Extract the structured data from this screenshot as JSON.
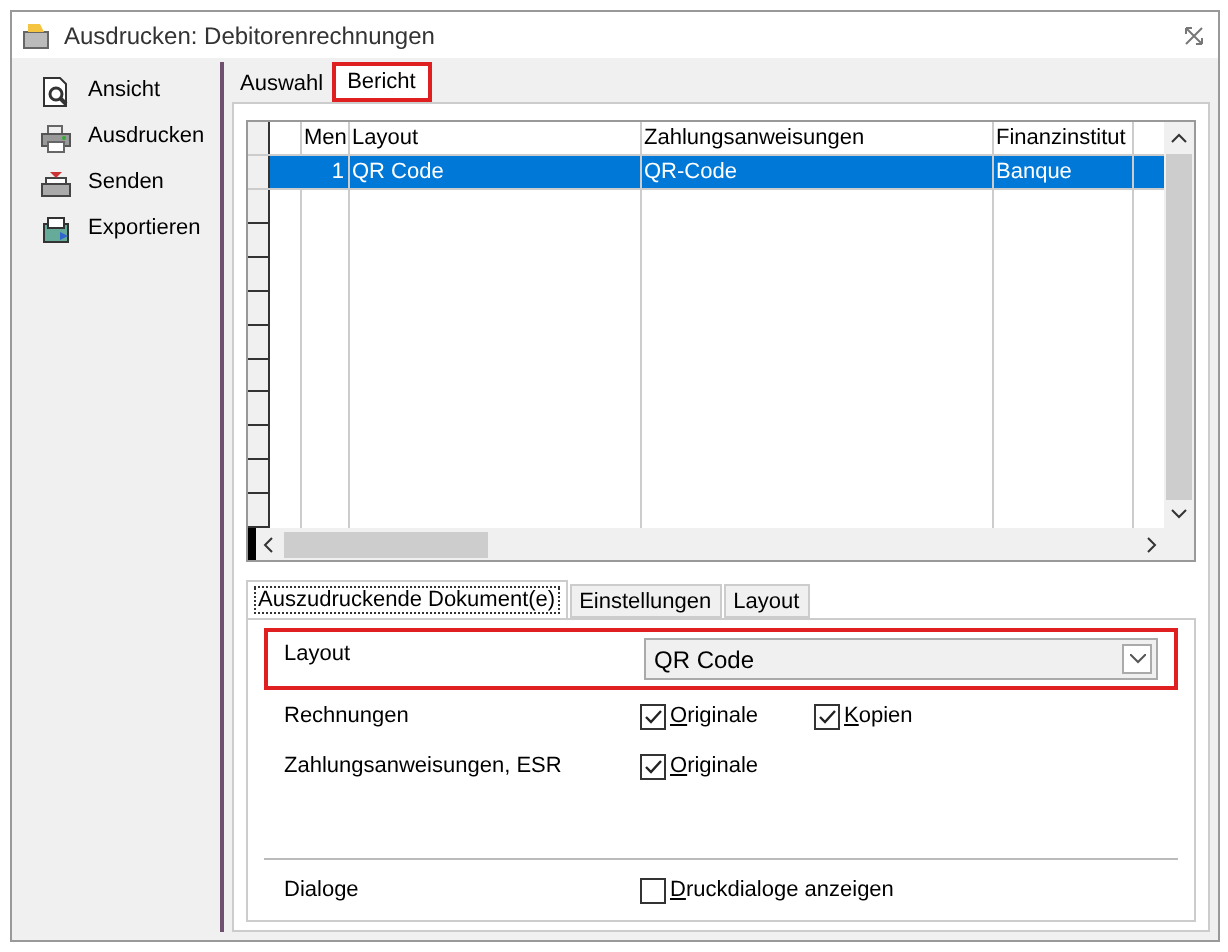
{
  "window": {
    "title": "Ausdrucken: Debitorenrechnungen"
  },
  "sidebar": {
    "items": [
      {
        "label": "Ansicht",
        "kind": "preview"
      },
      {
        "label": "Ausdrucken",
        "kind": "print"
      },
      {
        "label": "Senden",
        "kind": "send"
      },
      {
        "label": "Exportieren",
        "kind": "export"
      }
    ]
  },
  "tabs": [
    {
      "label": "Auswahl",
      "selected": false
    },
    {
      "label": "Bericht",
      "selected": true
    }
  ],
  "table": {
    "columns": [
      "Men",
      "Layout",
      "Zahlungsanweisungen",
      "Finanzinstitut"
    ],
    "rows": [
      {
        "cells": [
          "1",
          "QR Code",
          "QR-Code",
          "Banque"
        ],
        "selected": true
      }
    ]
  },
  "subtabs": [
    {
      "label": "Auszudruckende Dokument(e)",
      "selected": true
    },
    {
      "label": "Einstellungen",
      "selected": false
    },
    {
      "label": "Layout",
      "selected": false
    }
  ],
  "form": {
    "layout": {
      "label": "Layout",
      "value": "QR Code"
    },
    "rows": [
      {
        "label": "Rechnungen",
        "options": [
          {
            "label": "Originale",
            "checked": true
          },
          {
            "label": "Kopien",
            "checked": true
          }
        ]
      },
      {
        "label": "Zahlungsanweisungen, ESR",
        "options": [
          {
            "label": "Originale",
            "checked": true
          }
        ]
      }
    ],
    "dialogs": {
      "label": "Dialoge",
      "options": [
        {
          "label": "Druckdialoge anzeigen",
          "checked": false
        }
      ]
    }
  }
}
